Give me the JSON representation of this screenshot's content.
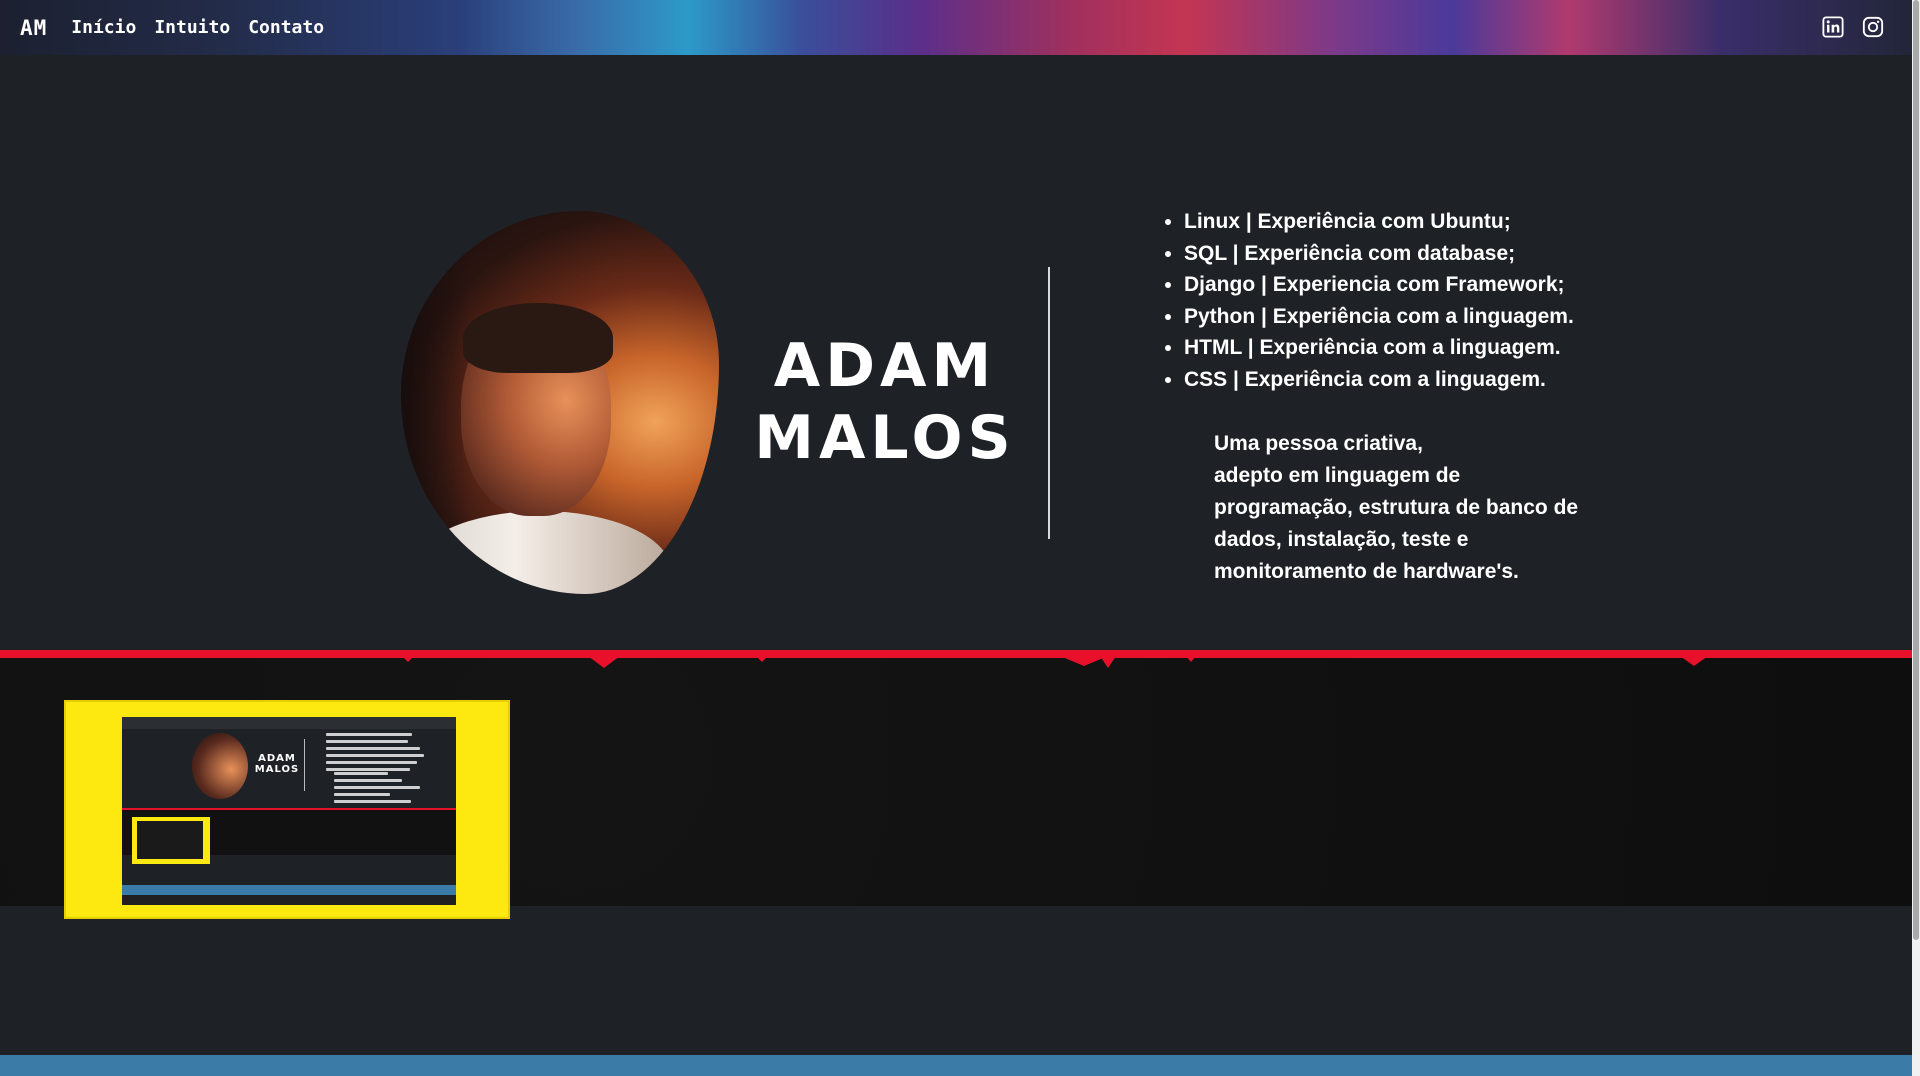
{
  "nav": {
    "logo": "AM",
    "links": [
      "Início",
      "Intuito",
      "Contato"
    ],
    "social": [
      {
        "icon": "linkedin-icon"
      },
      {
        "icon": "instagram-icon"
      }
    ]
  },
  "hero": {
    "name_line1": "ADAM",
    "name_line2": "MALOS",
    "skills": [
      "Linux | Experiência com Ubuntu;",
      "SQL | Experiência com database;",
      "Django | Experiencia com Framework;",
      "Python | Experiência com a linguagem.",
      "HTML | Experiência com a linguagem.",
      "CSS | Experiência com a linguagem."
    ],
    "bio_lines": [
      "Uma pessoa criativa,",
      "adepto em linguagem de",
      "programação, estrutura de banco de",
      "dados, instalação, teste e",
      "monitoramento de hardware's."
    ]
  },
  "colors": {
    "background": "#1e2126",
    "accent_red": "#e8102a",
    "card_yellow": "#fde910",
    "bottom_blue": "#3a7ba8"
  }
}
